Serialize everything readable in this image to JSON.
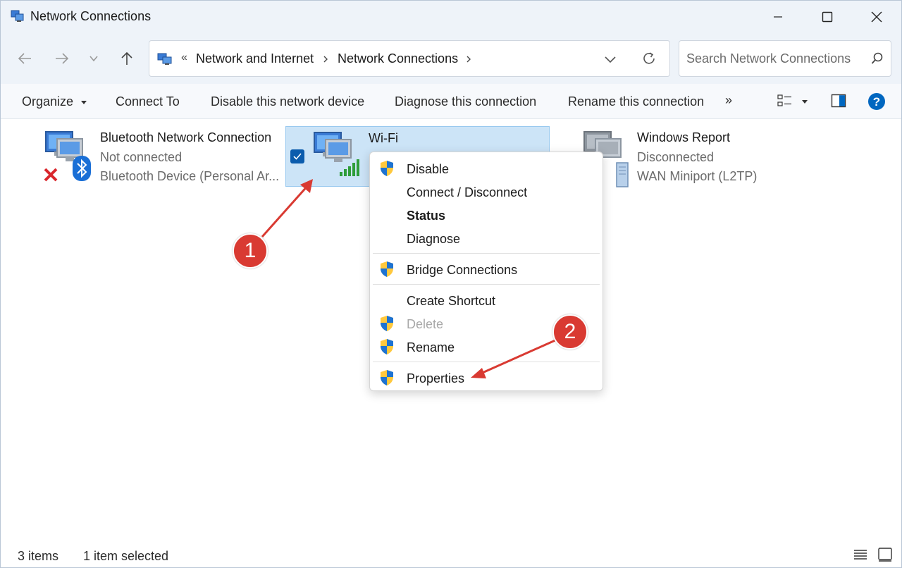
{
  "window": {
    "title": "Network Connections"
  },
  "address": {
    "overflow": "«",
    "crumbs": [
      "Network and Internet",
      "Network Connections"
    ]
  },
  "search": {
    "placeholder": "Search Network Connections"
  },
  "toolbar": {
    "organize": "Organize",
    "connect_to": "Connect To",
    "disable": "Disable this network device",
    "diagnose": "Diagnose this connection",
    "rename": "Rename this connection",
    "more": "»"
  },
  "connections": [
    {
      "name": "Bluetooth Network Connection",
      "status": "Not connected",
      "device": "Bluetooth Device (Personal Ar..."
    },
    {
      "name": "Wi-Fi",
      "status": "",
      "device": ""
    },
    {
      "name": "Windows Report",
      "status": "Disconnected",
      "device": "WAN Miniport (L2TP)"
    }
  ],
  "context_menu": {
    "items": [
      {
        "label": "Disable",
        "shield": true
      },
      {
        "label": "Connect / Disconnect",
        "shield": false
      },
      {
        "label": "Status",
        "shield": false,
        "bold": true
      },
      {
        "label": "Diagnose",
        "shield": false
      },
      {
        "label": "Bridge Connections",
        "shield": true
      },
      {
        "label": "Create Shortcut",
        "shield": false
      },
      {
        "label": "Delete",
        "shield": true,
        "disabled": true
      },
      {
        "label": "Rename",
        "shield": true
      },
      {
        "label": "Properties",
        "shield": true
      }
    ]
  },
  "annotations": {
    "step1": "1",
    "step2": "2"
  },
  "status_bar": {
    "items": "3 items",
    "selected": "1 item selected"
  },
  "colors": {
    "accent": "#0067c0",
    "selection": "#cce4f7",
    "annotation": "#d93a32"
  }
}
